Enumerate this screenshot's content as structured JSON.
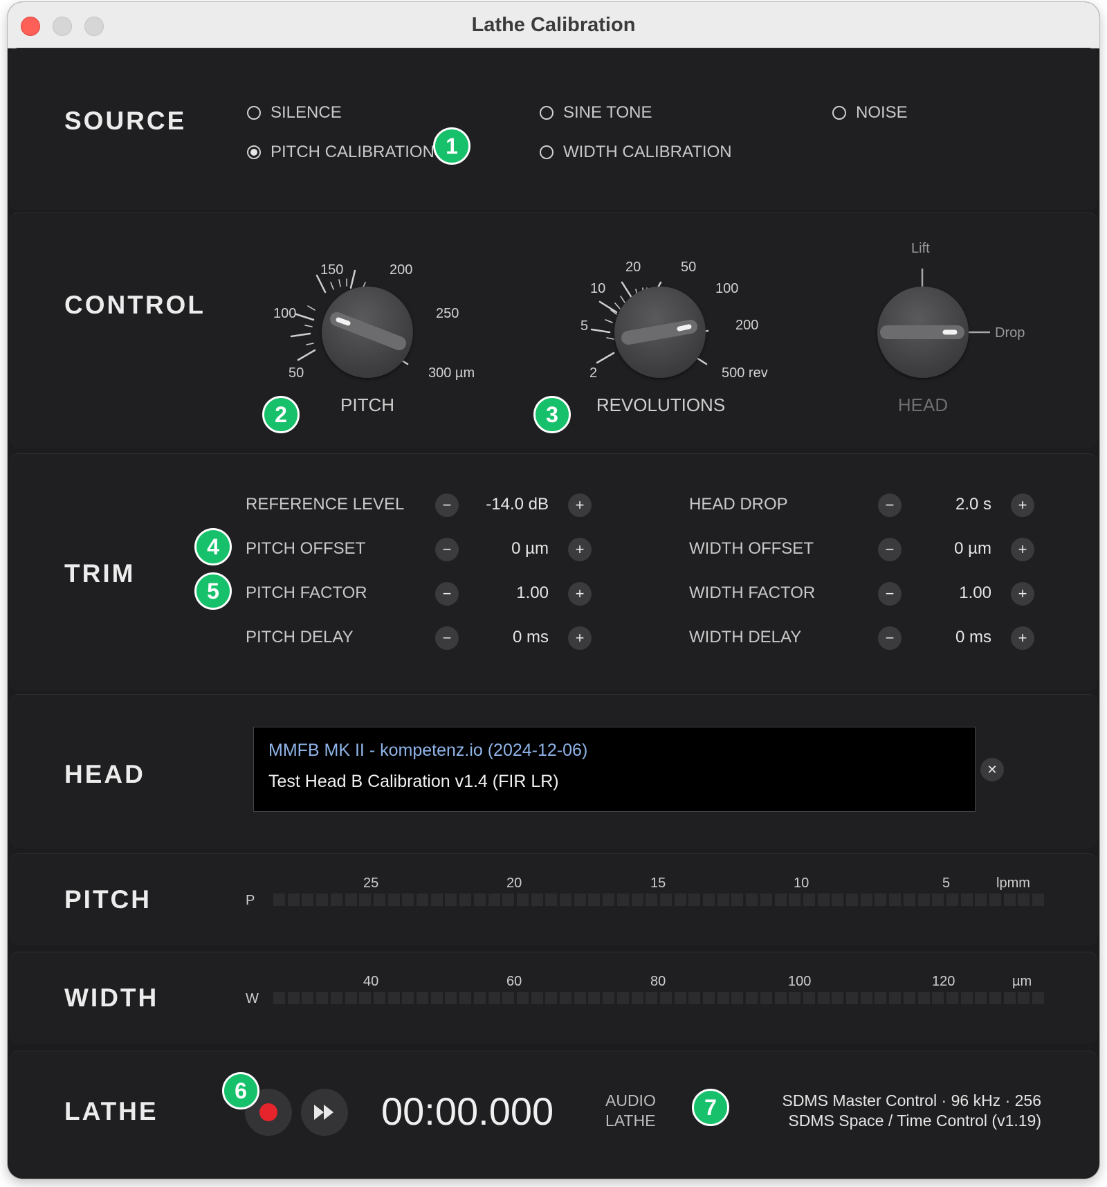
{
  "window": {
    "title": "Lathe Calibration"
  },
  "source": {
    "title": "SOURCE",
    "options": [
      "SILENCE",
      "SINE TONE",
      "NOISE",
      "PITCH CALIBRATION",
      "WIDTH CALIBRATION"
    ],
    "selected": "PITCH CALIBRATION"
  },
  "control": {
    "title": "CONTROL",
    "pitch": {
      "label": "PITCH",
      "scale": [
        "50",
        "100",
        "150",
        "200",
        "250",
        "300 µm"
      ]
    },
    "revolutions": {
      "label": "REVOLUTIONS",
      "scale": [
        "2",
        "5",
        "10",
        "20",
        "50",
        "100",
        "200",
        "500 rev"
      ]
    },
    "head": {
      "label": "HEAD",
      "positions": [
        "Lift",
        "Drop"
      ]
    }
  },
  "trim": {
    "title": "TRIM",
    "left": [
      {
        "label": "REFERENCE LEVEL",
        "value": "-14.0 dB"
      },
      {
        "label": "PITCH OFFSET",
        "value": "0 µm"
      },
      {
        "label": "PITCH FACTOR",
        "value": "1.00"
      },
      {
        "label": "PITCH DELAY",
        "value": "0 ms"
      }
    ],
    "right": [
      {
        "label": "HEAD DROP",
        "value": "2.0 s"
      },
      {
        "label": "WIDTH OFFSET",
        "value": "0 µm"
      },
      {
        "label": "WIDTH FACTOR",
        "value": "1.00"
      },
      {
        "label": "WIDTH DELAY",
        "value": "0 ms"
      }
    ],
    "minus": "−",
    "plus": "+"
  },
  "head": {
    "title": "HEAD",
    "line1": "MMFB MK II - kompetenz.io (2024-12-06)",
    "line2": "Test Head B Calibration v1.4 (FIR LR)",
    "clear": "✕"
  },
  "pitch_meter": {
    "title": "PITCH",
    "channel": "P",
    "ticks": [
      "25",
      "20",
      "15",
      "10",
      "5"
    ],
    "unit": "lpmm"
  },
  "width_meter": {
    "title": "WIDTH",
    "channel": "W",
    "ticks": [
      "40",
      "60",
      "80",
      "100",
      "120"
    ],
    "unit": "µm"
  },
  "lathe": {
    "title": "LATHE",
    "time": "00:00.000",
    "mode_line1": "AUDIO",
    "mode_line2": "LATHE",
    "status_line1": "SDMS Master Control · 96 kHz · 256",
    "status_line2": "SDMS Space / Time Control (v1.19)"
  },
  "badges": [
    "1",
    "2",
    "3",
    "4",
    "5",
    "6",
    "7"
  ],
  "colors": {
    "accent": "#17c06a",
    "record": "#e5242b",
    "link": "#8fb4e8"
  }
}
